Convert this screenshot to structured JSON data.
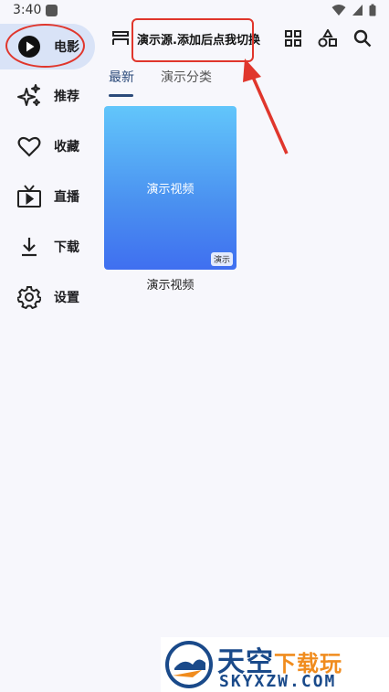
{
  "status_bar": {
    "time": "3:40"
  },
  "rail": {
    "items": [
      {
        "label": "电影",
        "icon": "play-circle-icon",
        "active": true
      },
      {
        "label": "推荐",
        "icon": "sparkle-icon"
      },
      {
        "label": "收藏",
        "icon": "heart-icon"
      },
      {
        "label": "直播",
        "icon": "tv-icon"
      },
      {
        "label": "下载",
        "icon": "download-icon"
      },
      {
        "label": "设置",
        "icon": "gear-icon"
      }
    ]
  },
  "topbar": {
    "source_title": "演示源.添加后点我切换",
    "icons": [
      "source-icon",
      "grid-icon",
      "category-icon",
      "search-icon"
    ]
  },
  "tabs": [
    {
      "label": "最新",
      "active": true
    },
    {
      "label": "演示分类"
    }
  ],
  "cards": [
    {
      "title": "演示视频",
      "badge": "演示",
      "caption": "演示视频"
    }
  ],
  "watermark": {
    "main": "天空",
    "accent": "下载玩",
    "sub": "SKYXZW.COM"
  },
  "colors": {
    "accent": "#2b4a7a",
    "active_bg": "#d9e3f7",
    "annotation": "#e0362c"
  }
}
